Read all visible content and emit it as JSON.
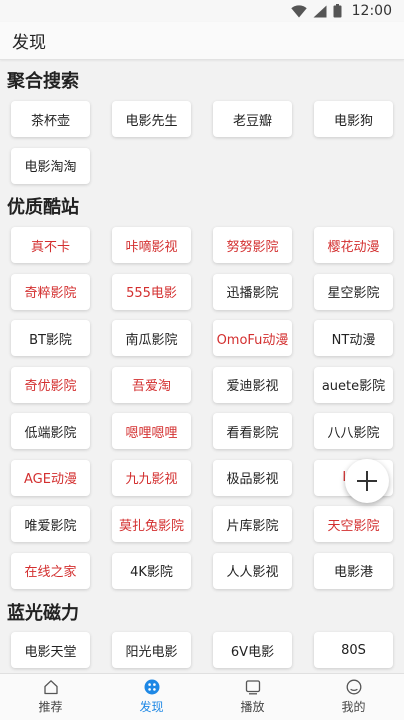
{
  "status_bar": {
    "time": "12:00"
  },
  "app_bar": {
    "title": "发现"
  },
  "colors": {
    "accent": "#1e88e5",
    "highlight_text": "#d32f2f"
  },
  "sections": {
    "aggregate_search": {
      "title": "聚合搜索",
      "items": [
        {
          "label": "茶杯壶",
          "highlight": false
        },
        {
          "label": "电影先生",
          "highlight": false
        },
        {
          "label": "老豆瓣",
          "highlight": false
        },
        {
          "label": "电影狗",
          "highlight": false
        },
        {
          "label": "电影淘淘",
          "highlight": false
        }
      ]
    },
    "quality_sites": {
      "title": "优质酷站",
      "items": [
        {
          "label": "真不卡",
          "highlight": true
        },
        {
          "label": "咔嘀影视",
          "highlight": true
        },
        {
          "label": "努努影院",
          "highlight": true
        },
        {
          "label": "樱花动漫",
          "highlight": true
        },
        {
          "label": "奇粹影院",
          "highlight": true
        },
        {
          "label": "555电影",
          "highlight": true
        },
        {
          "label": "迅播影院",
          "highlight": false
        },
        {
          "label": "星空影院",
          "highlight": false
        },
        {
          "label": "BT影院",
          "highlight": false
        },
        {
          "label": "南瓜影院",
          "highlight": false
        },
        {
          "label": "OmoFu动漫",
          "highlight": true
        },
        {
          "label": "NT动漫",
          "highlight": false
        },
        {
          "label": "奇优影院",
          "highlight": true
        },
        {
          "label": "吾爱淘",
          "highlight": true
        },
        {
          "label": "爱迪影视",
          "highlight": false
        },
        {
          "label": "auete影院",
          "highlight": false
        },
        {
          "label": "低端影院",
          "highlight": false
        },
        {
          "label": "嗯哩嗯哩",
          "highlight": true
        },
        {
          "label": "看看影院",
          "highlight": false
        },
        {
          "label": "八八影院",
          "highlight": false
        },
        {
          "label": "AGE动漫",
          "highlight": true
        },
        {
          "label": "九九影视",
          "highlight": true
        },
        {
          "label": "极品影视",
          "highlight": false
        },
        {
          "label": "LIM",
          "highlight": true
        },
        {
          "label": "唯爱影院",
          "highlight": false
        },
        {
          "label": "莫扎兔影院",
          "highlight": true
        },
        {
          "label": "片库影院",
          "highlight": false
        },
        {
          "label": "天空影院",
          "highlight": true
        },
        {
          "label": "在线之家",
          "highlight": true
        },
        {
          "label": "4K影院",
          "highlight": false
        },
        {
          "label": "人人影视",
          "highlight": false
        },
        {
          "label": "电影港",
          "highlight": false
        }
      ]
    },
    "bluray_magnet": {
      "title": "蓝光磁力",
      "items": [
        {
          "label": "电影天堂",
          "highlight": false
        },
        {
          "label": "阳光电影",
          "highlight": false
        },
        {
          "label": "6V电影",
          "highlight": false
        },
        {
          "label": "80S",
          "highlight": false
        }
      ]
    }
  },
  "bottom_nav": [
    {
      "label": "推荐",
      "icon": "home-icon",
      "active": false
    },
    {
      "label": "发现",
      "icon": "discover-icon",
      "active": true
    },
    {
      "label": "播放",
      "icon": "player-icon",
      "active": false
    },
    {
      "label": "我的",
      "icon": "profile-icon",
      "active": false
    }
  ]
}
